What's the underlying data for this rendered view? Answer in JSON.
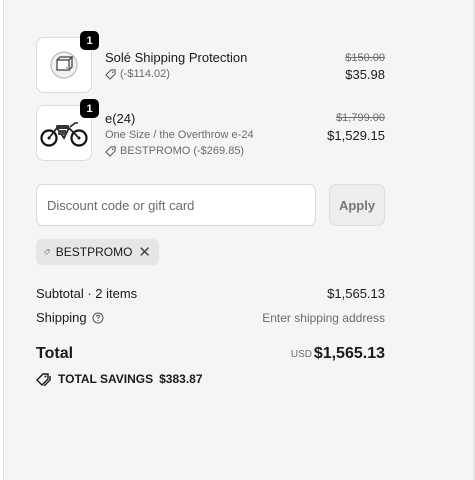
{
  "items": [
    {
      "quantity": "1",
      "name": "Solé Shipping Protection",
      "discount": "(-$114.02)",
      "original_price": "$150.00",
      "price": "$35.98",
      "icon": "shipping-protection-icon"
    },
    {
      "quantity": "1",
      "name": "e(24)",
      "variant": "One Size / the Overthrow e-24",
      "discount": "BESTPROMO (-$269.85)",
      "original_price": "$1,799.00",
      "price": "$1,529.15",
      "icon": "ebike-icon"
    }
  ],
  "discount_form": {
    "placeholder": "Discount code or gift card",
    "apply_label": "Apply"
  },
  "applied_code": "BESTPROMO",
  "summary": {
    "subtotal_label": "Subtotal · 2 items",
    "subtotal_value": "$1,565.13",
    "shipping_label": "Shipping",
    "shipping_value": "Enter shipping address",
    "total_label": "Total",
    "currency": "USD",
    "total_value": "$1,565.13",
    "savings_label": "TOTAL SAVINGS",
    "savings_value": "$383.87"
  },
  "colors": {
    "background": "#f5f5f5",
    "text": "#1a1a1a",
    "muted": "#6b6b6b",
    "badge": "#000000"
  }
}
